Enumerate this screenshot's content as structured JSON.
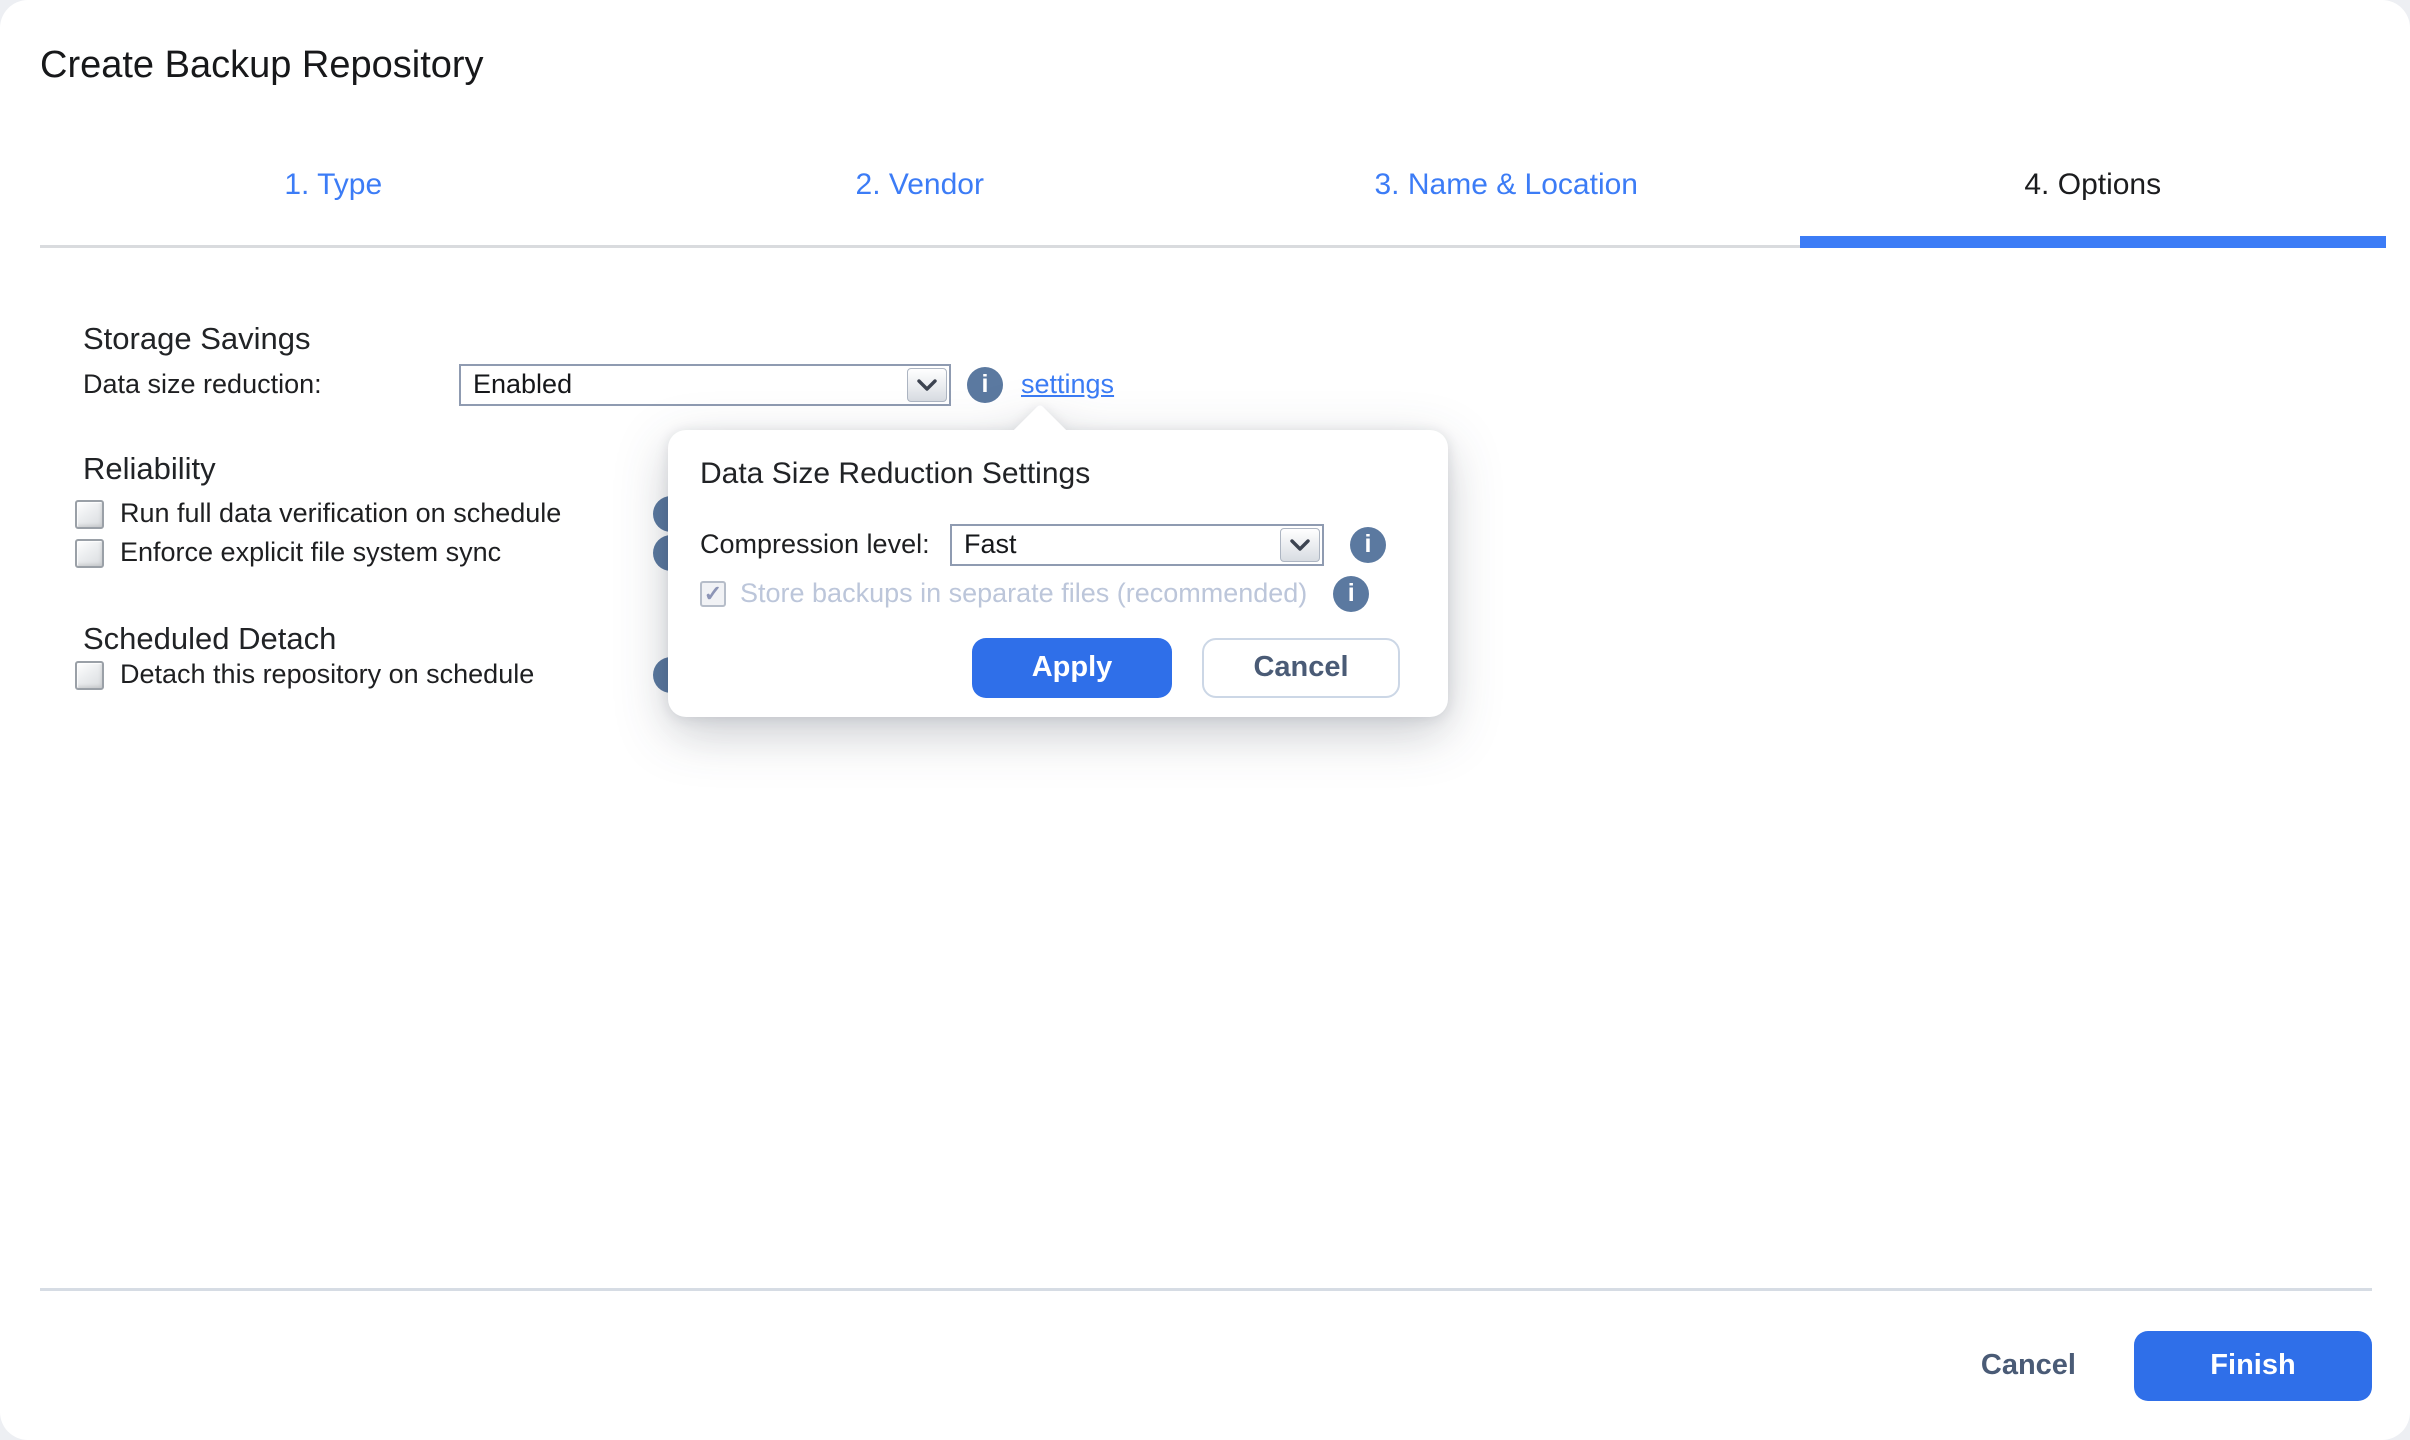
{
  "window": {
    "title": "Create Backup Repository"
  },
  "tabs": [
    {
      "label": "1. Type"
    },
    {
      "label": "2. Vendor"
    },
    {
      "label": "3. Name & Location"
    },
    {
      "label": "4. Options"
    }
  ],
  "storage": {
    "heading": "Storage Savings",
    "label": "Data size reduction:",
    "value": "Enabled",
    "settings_link": "settings"
  },
  "reliability": {
    "heading": "Reliability",
    "cb1": "Run full data verification on schedule",
    "cb2": "Enforce explicit file system sync"
  },
  "detach": {
    "heading": "Scheduled Detach",
    "cb1": "Detach this repository on schedule"
  },
  "popover": {
    "title": "Data Size Reduction Settings",
    "compression_label": "Compression level:",
    "compression_value": "Fast",
    "store_label": "Store backups in separate files (recommended)",
    "apply": "Apply",
    "cancel": "Cancel"
  },
  "footer": {
    "cancel": "Cancel",
    "finish": "Finish"
  },
  "icons": {
    "info_glyph": "i",
    "check_glyph": "✓"
  },
  "colors": {
    "tab_link_blue": "#3c7cf6",
    "button_blue": "#2f6fe9",
    "info_icon_blue": "#5b79a0",
    "disabled_text": "#bcc6da"
  }
}
